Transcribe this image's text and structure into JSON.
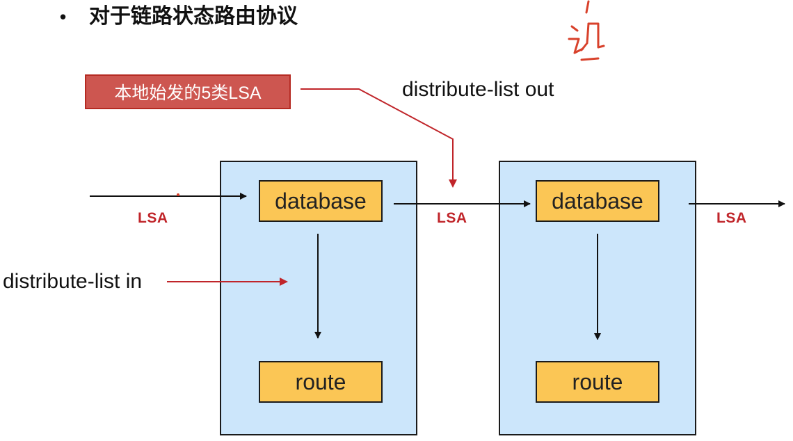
{
  "heading": {
    "bullet": "•",
    "text": "对于链路状态路由协议"
  },
  "redbox": {
    "text": "本地始发的5类LSA"
  },
  "labels": {
    "distribute_out": "distribute-list out",
    "distribute_in": "distribute-list in"
  },
  "routers": [
    {
      "database": "database",
      "route": "route"
    },
    {
      "database": "database",
      "route": "route"
    }
  ],
  "lsa_labels": [
    "LSA",
    "LSA",
    "LSA"
  ],
  "handwriting": {
    "text": "'讯"
  },
  "colors": {
    "router_fill": "#cce6fb",
    "cell_fill": "#fbc655",
    "accent_red": "#c0252a"
  }
}
